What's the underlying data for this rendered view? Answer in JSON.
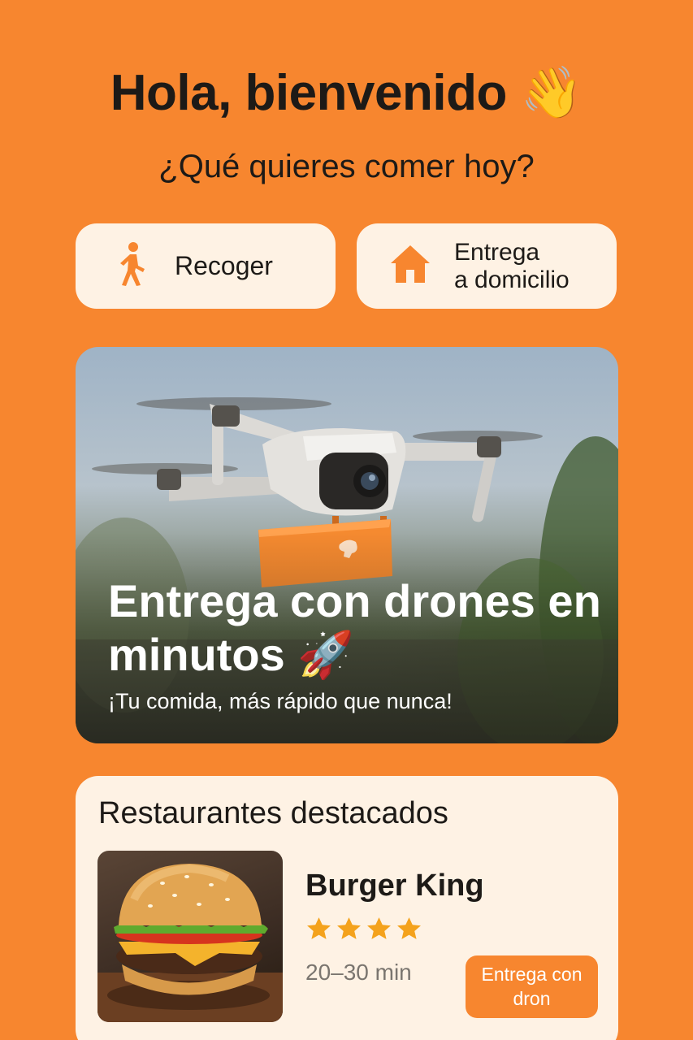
{
  "greeting": "Hola, bienvenido 👋",
  "subtitle": "¿Qué quieres comer hoy?",
  "modes": {
    "pickup": {
      "label": "Recoger",
      "icon": "walking-person-icon"
    },
    "delivery": {
      "label_line1": "Entrega",
      "label_line2": "a domicilio",
      "icon": "house-icon"
    }
  },
  "hero": {
    "title": "Entrega con drones en minutos 🚀",
    "subtitle": "¡Tu comida, más rápido que nunca!"
  },
  "featured": {
    "title": "Restaurantes destacados",
    "restaurant": {
      "name": "Burger King",
      "rating": 4,
      "max_rating": 4,
      "time": "20–30 min",
      "badge_line1": "Entrega con",
      "badge_line2": "dron"
    }
  },
  "colors": {
    "accent": "#F7862F",
    "card": "#FEF2E4",
    "star": "#F4A21C",
    "text": "#1d1a17"
  }
}
